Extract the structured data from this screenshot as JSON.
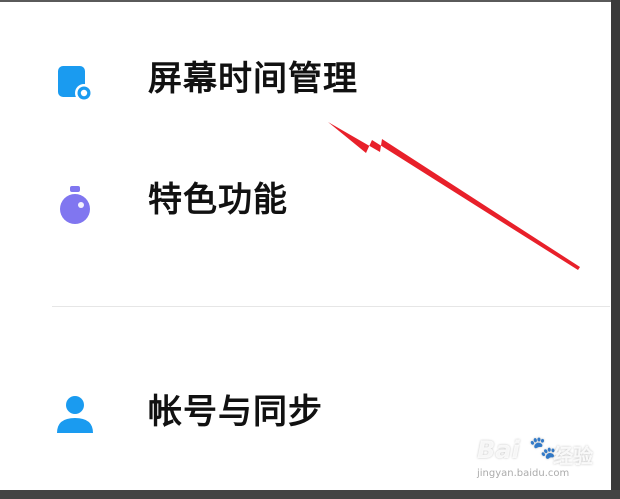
{
  "settings": {
    "items": [
      {
        "label": "屏幕时间管理",
        "icon": "screen-time-icon",
        "icon_color": "#1a9bf0"
      },
      {
        "label": "特色功能",
        "icon": "features-icon",
        "icon_color": "#8076f0"
      },
      {
        "label": "帐号与同步",
        "icon": "account-icon",
        "icon_color": "#1a9bf0"
      }
    ]
  },
  "annotation": {
    "arrow_color": "#e8202a"
  },
  "watermark": {
    "brand": "Bai",
    "paw": "🐾",
    "sub": "经验",
    "url": "jingyan.baidu.com"
  }
}
